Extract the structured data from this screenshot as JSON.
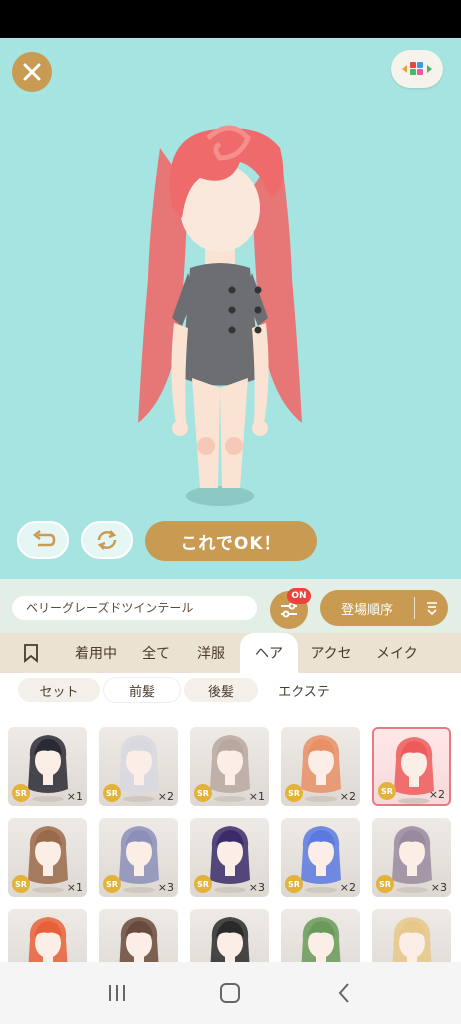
{
  "toolbar": {
    "item_name": "ベリーグレーズドツインテール",
    "filter_badge": "ON",
    "sort_label": "登場順序"
  },
  "stage": {
    "ok_label": "これでOK！"
  },
  "tabs": [
    {
      "label": "着用中"
    },
    {
      "label": "全て"
    },
    {
      "label": "洋服"
    },
    {
      "label": "ヘア"
    },
    {
      "label": "アクセ"
    },
    {
      "label": "メイク"
    }
  ],
  "subtabs": [
    {
      "label": "セット"
    },
    {
      "label": "前髪"
    },
    {
      "label": "後髪"
    },
    {
      "label": "エクステ"
    }
  ],
  "items": [
    {
      "rarity": "SR",
      "count": "×1",
      "hair": "#2a2a34"
    },
    {
      "rarity": "SR",
      "count": "×2",
      "hair": "#d8d8e0"
    },
    {
      "rarity": "SR",
      "count": "×1",
      "hair": "#b8a8a0"
    },
    {
      "rarity": "SR",
      "count": "×2",
      "hair": "#e89066"
    },
    {
      "rarity": "SR",
      "count": "×2",
      "hair": "#ee5a5a"
    },
    {
      "rarity": "SR",
      "count": "×1",
      "hair": "#9a6a4a"
    },
    {
      "rarity": "SR",
      "count": "×3",
      "hair": "#8c8fb8"
    },
    {
      "rarity": "SR",
      "count": "×3",
      "hair": "#3a2c6a"
    },
    {
      "rarity": "SR",
      "count": "×2",
      "hair": "#5a7ae0"
    },
    {
      "rarity": "SR",
      "count": "×3",
      "hair": "#9a8aa0"
    },
    {
      "rarity": "",
      "count": "",
      "hair": "#e8603a"
    },
    {
      "rarity": "",
      "count": "",
      "hair": "#6a4a3a"
    },
    {
      "rarity": "",
      "count": "",
      "hair": "#2a2a2a"
    },
    {
      "rarity": "",
      "count": "",
      "hair": "#6a9a5a"
    },
    {
      "rarity": "",
      "count": "",
      "hair": "#e8c88a"
    }
  ],
  "colors": {
    "accent_gold": "#c89a52",
    "stage_bg": "#a6e4e1",
    "character_hair": "#ef6a6a"
  },
  "icons": {
    "close": "close-icon",
    "palette": "palette-icon",
    "undo": "undo-icon",
    "reset": "refresh-icon",
    "filter": "sliders-icon",
    "sort": "sort-icon",
    "bookmark": "bookmark-icon"
  }
}
